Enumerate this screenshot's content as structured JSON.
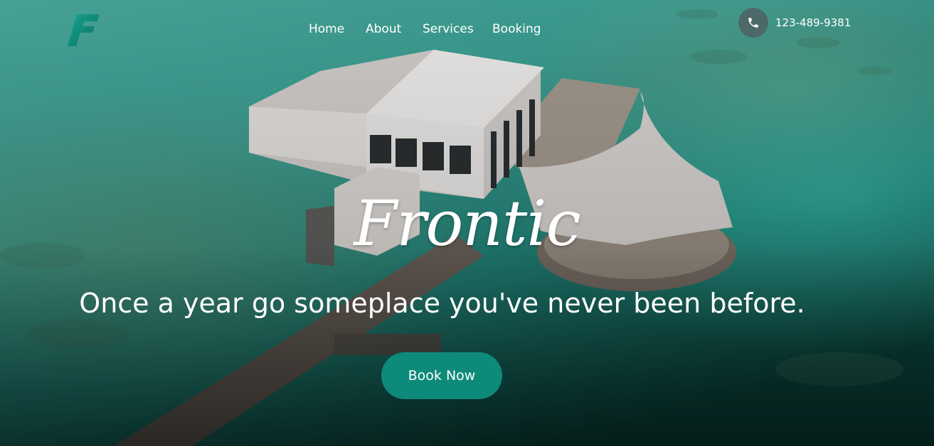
{
  "logo": {
    "letter": "F",
    "color": "#0e8a7b"
  },
  "nav": {
    "home": "Home",
    "about": "About",
    "services": "Services",
    "booking": "Booking"
  },
  "contact": {
    "icon": "phone-icon",
    "phone": "123-489-9381"
  },
  "hero": {
    "brand": "Frontic",
    "tagline": "Once a year go someplace you've never been before.",
    "cta_label": "Book Now"
  },
  "colors": {
    "accent": "#0e8a7b",
    "water_light": "#43b3a5",
    "water_dark": "#0b3b36",
    "text": "#ffffff"
  }
}
